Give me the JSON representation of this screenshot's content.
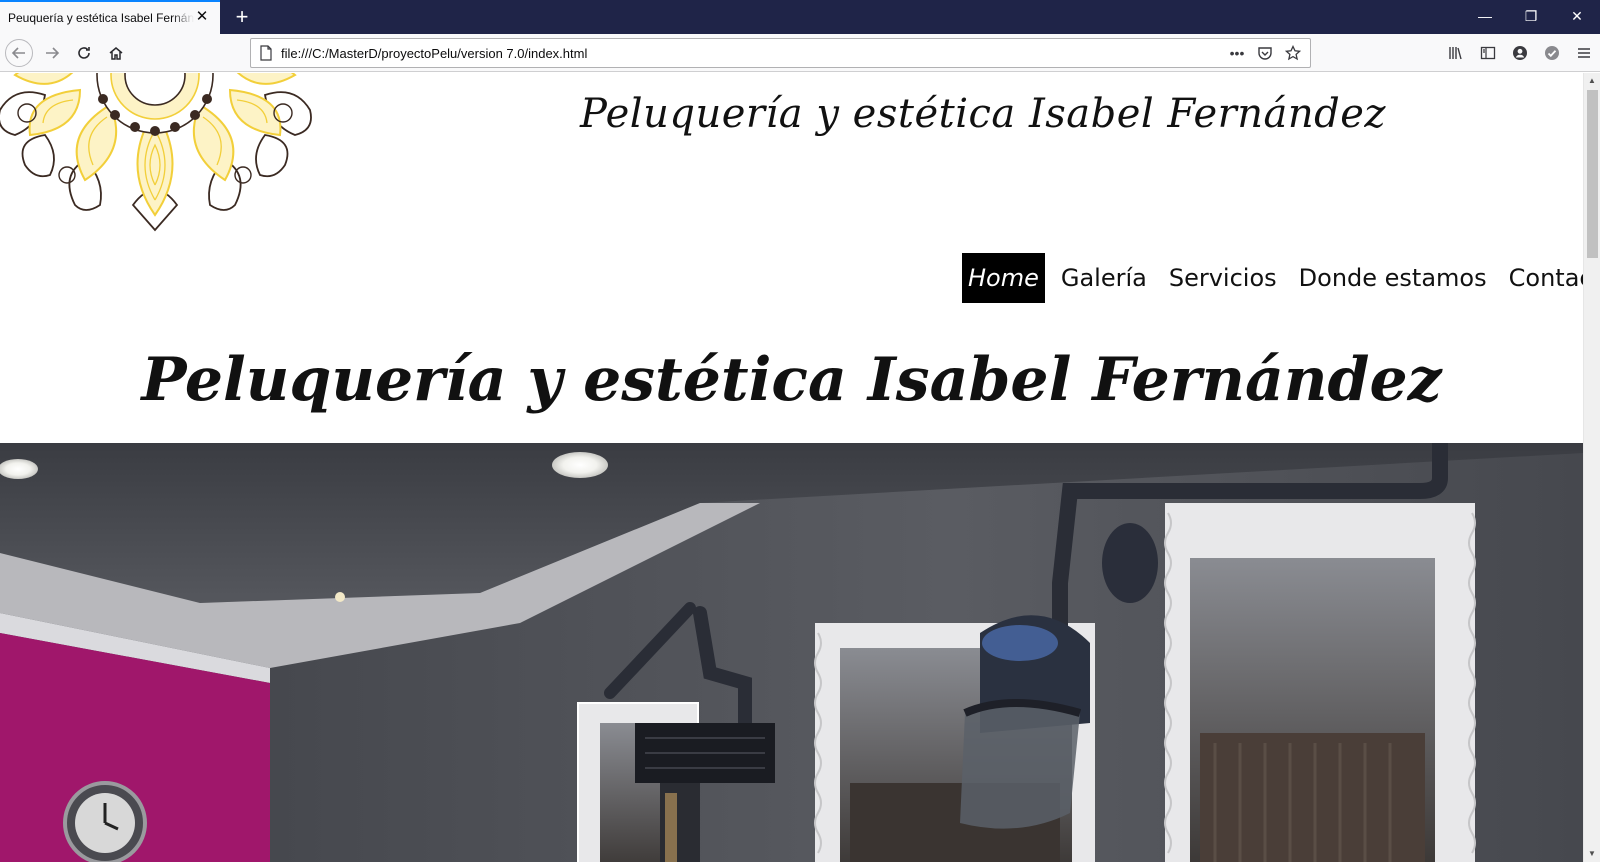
{
  "browser": {
    "tab_title": "Peuquería y estética Isabel Fernández",
    "tab_close": "✕",
    "new_tab": "+",
    "url": "file:///C:/MasterD/proyectoPelu/version 7.0/index.html",
    "window_controls": {
      "minimize": "—",
      "restore": "❐",
      "close": "✕"
    },
    "url_actions_more": "•••"
  },
  "site": {
    "title": "Peluquería y estética Isabel Fernández",
    "hero_title": "Peluquería y estética Isabel Fernández",
    "nav": [
      {
        "label": "Home",
        "active": true
      },
      {
        "label": "Galería",
        "active": false
      },
      {
        "label": "Servicios",
        "active": false
      },
      {
        "label": "Donde estamos",
        "active": false
      },
      {
        "label": "Contacto",
        "active": false
      }
    ]
  },
  "colors": {
    "tabbar": "#1f2448",
    "tab_accent": "#0a84ff",
    "mandala_yellow": "#f5d547",
    "mandala_outline": "#3b2a22",
    "wall_magenta": "#a0176b",
    "wall_gray": "#4a4c52"
  }
}
